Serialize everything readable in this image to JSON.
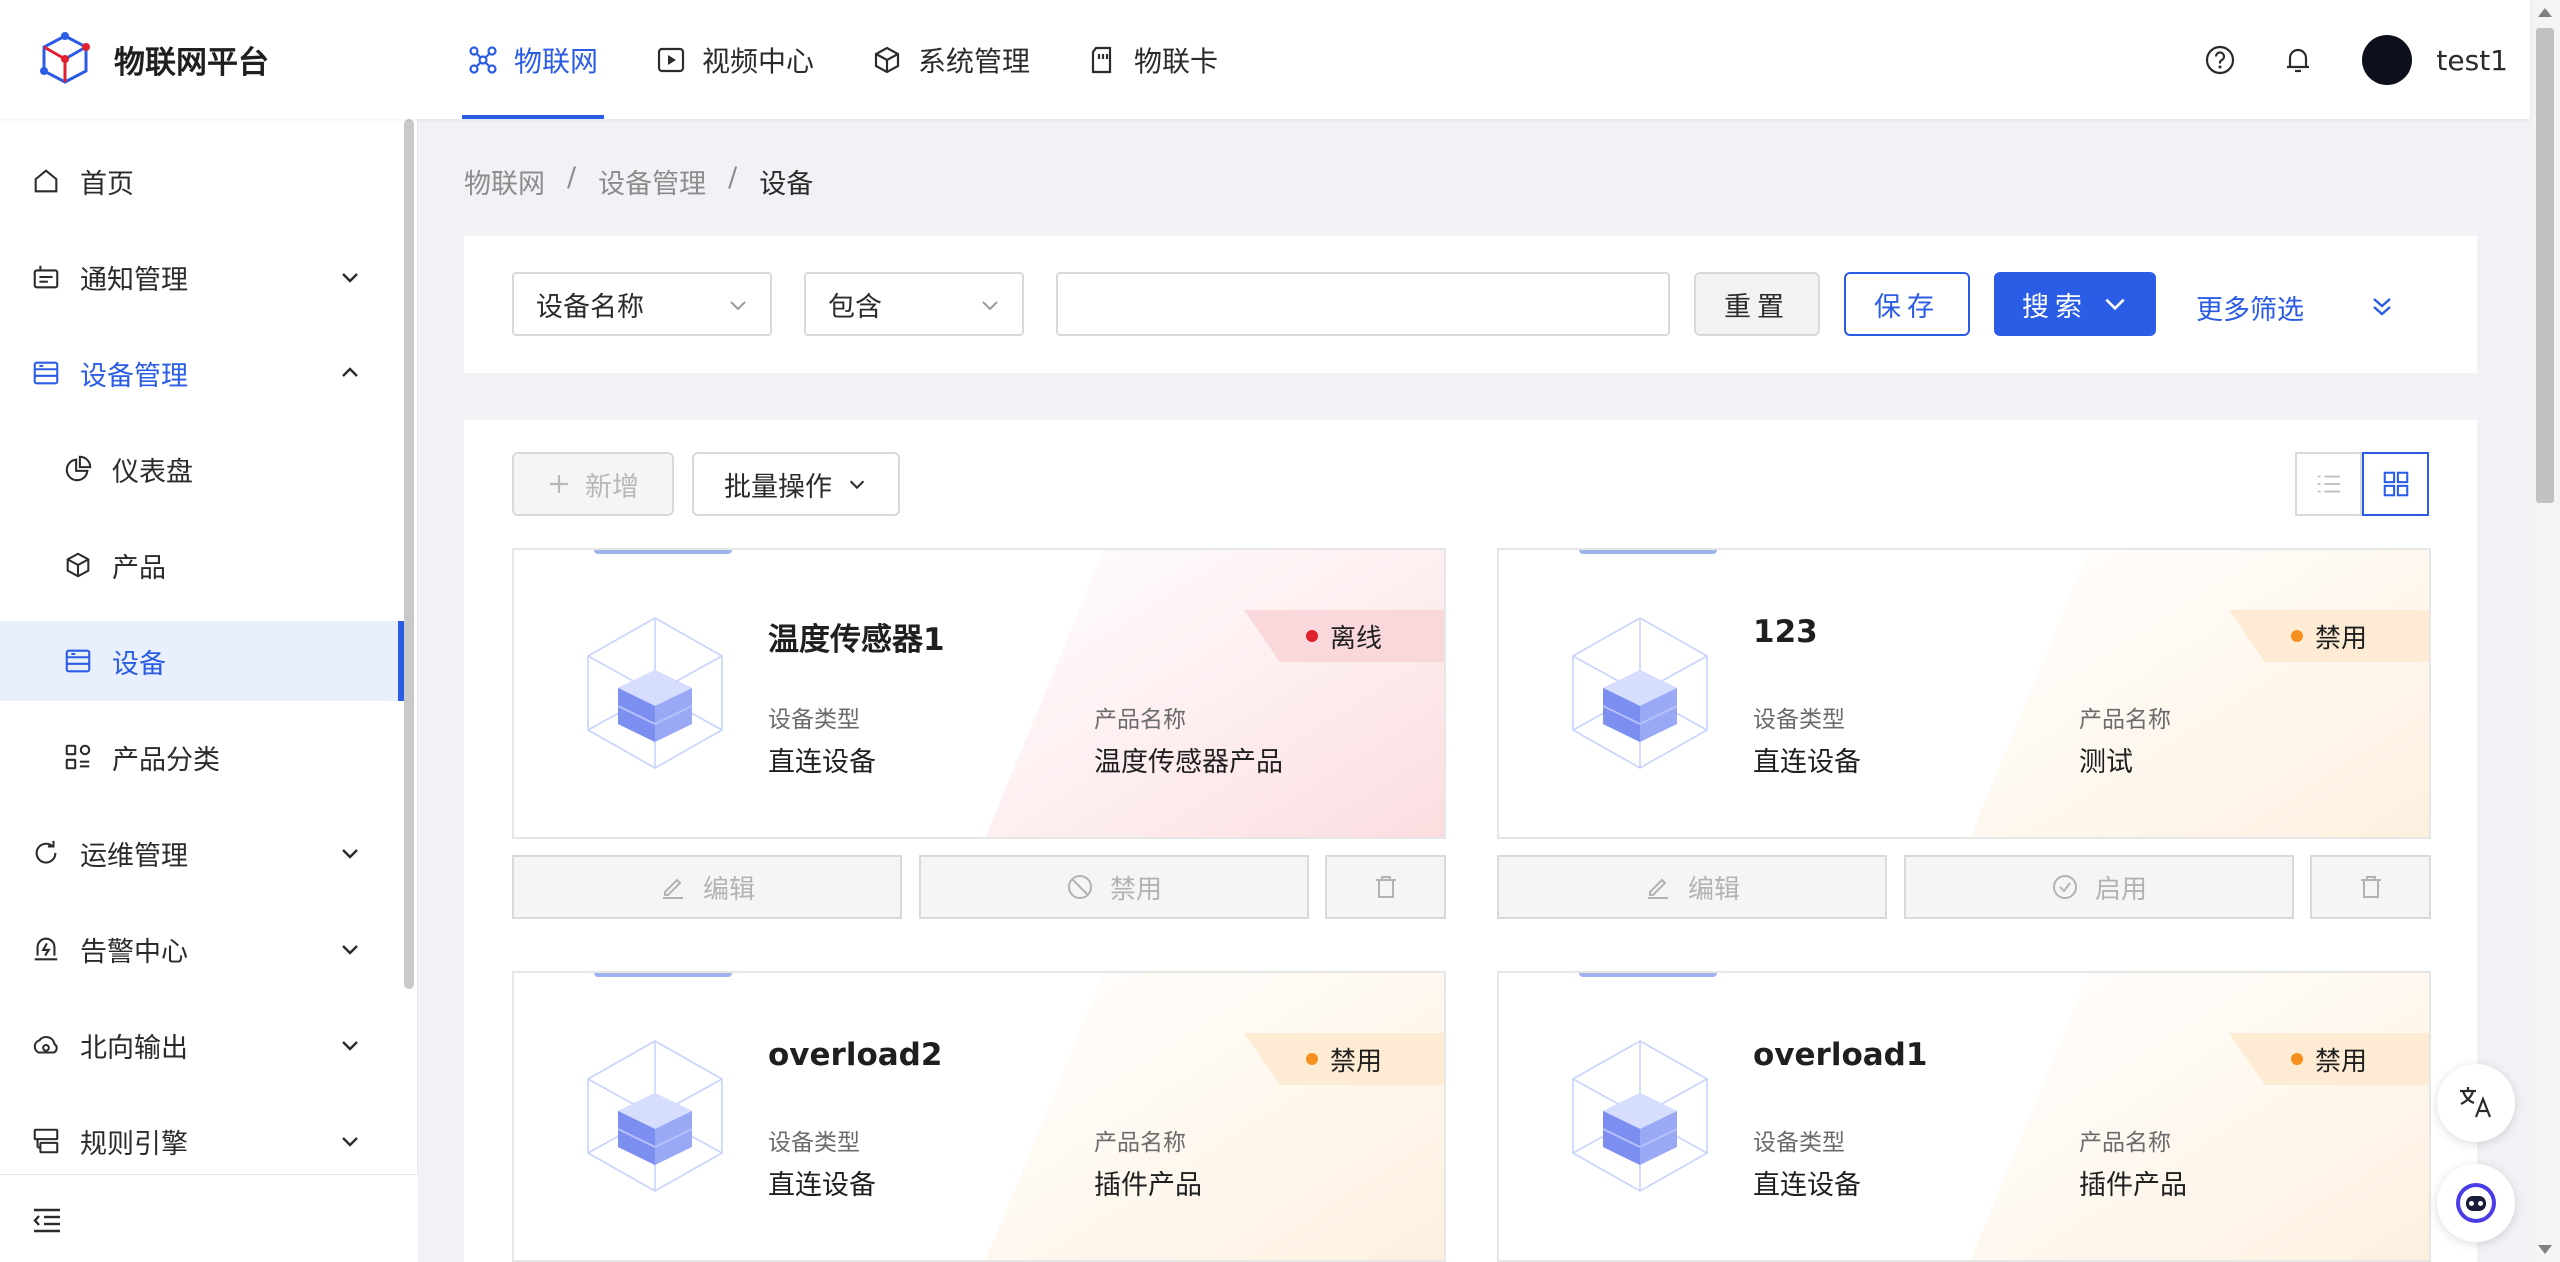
{
  "app": {
    "title": "物联网平台"
  },
  "topnav": [
    {
      "label": "物联网",
      "icon": "iot-network-icon",
      "active": true
    },
    {
      "label": "视频中心",
      "icon": "video-play-icon"
    },
    {
      "label": "系统管理",
      "icon": "cube-settings-icon"
    },
    {
      "label": "物联卡",
      "icon": "sim-card-icon"
    }
  ],
  "user": {
    "name": "test1"
  },
  "sidebar": {
    "items": [
      {
        "label": "首页",
        "icon": "home-icon"
      },
      {
        "label": "通知管理",
        "icon": "notification-icon",
        "expandable": true
      },
      {
        "label": "设备管理",
        "icon": "device-manage-icon",
        "expanded": true
      },
      {
        "label": "仪表盘",
        "icon": "dashboard-pie-icon",
        "sub": true
      },
      {
        "label": "产品",
        "icon": "product-cube-icon",
        "sub": true
      },
      {
        "label": "设备",
        "icon": "device-icon",
        "sub": true,
        "active": true
      },
      {
        "label": "产品分类",
        "icon": "category-icon",
        "sub": true
      },
      {
        "label": "运维管理",
        "icon": "ops-icon",
        "expandable": true
      },
      {
        "label": "告警中心",
        "icon": "alarm-icon",
        "expandable": true
      },
      {
        "label": "北向输出",
        "icon": "northbound-icon",
        "expandable": true
      },
      {
        "label": "规则引擎",
        "icon": "rule-engine-icon",
        "expandable": true
      }
    ]
  },
  "breadcrumb": [
    "物联网",
    "设备管理",
    "设备"
  ],
  "filter": {
    "field": "设备名称",
    "operator": "包含",
    "value": "",
    "reset_label": "重置",
    "save_label": "保存",
    "search_label": "搜索",
    "more_label": "更多筛选"
  },
  "toolbar": {
    "add_label": "新增",
    "batch_label": "批量操作"
  },
  "devices": [
    {
      "name": "温度传感器1",
      "status": "离线",
      "status_kind": "offline",
      "type_label": "设备类型",
      "type": "直连设备",
      "product_label": "产品名称",
      "product": "温度传感器产品",
      "edit_label": "编辑",
      "toggle_label": "禁用",
      "toggle_icon": "ban-icon"
    },
    {
      "name": "123",
      "status": "禁用",
      "status_kind": "disabled",
      "type_label": "设备类型",
      "type": "直连设备",
      "product_label": "产品名称",
      "product": "测试",
      "edit_label": "编辑",
      "toggle_label": "启用",
      "toggle_icon": "check-circle-icon"
    },
    {
      "name": "overload2",
      "status": "禁用",
      "status_kind": "disabled",
      "type_label": "设备类型",
      "type": "直连设备",
      "product_label": "产品名称",
      "product": "插件产品"
    },
    {
      "name": "overload1",
      "status": "禁用",
      "status_kind": "disabled",
      "type_label": "设备类型",
      "type": "直连设备",
      "product_label": "产品名称",
      "product": "插件产品"
    }
  ],
  "colors": {
    "primary": "#2b5ce6",
    "offline": "#e0202e",
    "disabled": "#f5901e"
  }
}
